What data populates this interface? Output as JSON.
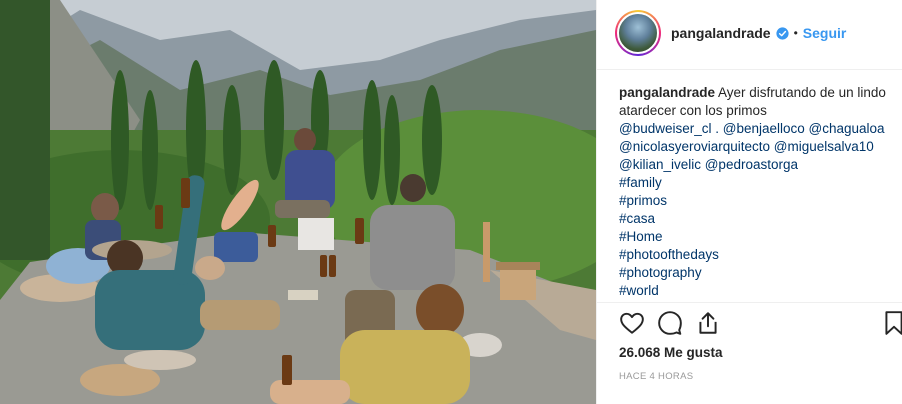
{
  "post": {
    "username": "pangalandrade",
    "follow_label": "Seguir",
    "dot": "•",
    "caption_user": "pangalandrade",
    "caption_text": " Ayer disfrutando de un lindo atardecer con los primos",
    "mentions_line1": "@budweiser_cl . @benjaelloco @chagualoa",
    "mentions_line2": "@nicolasyeroviarquitecto @miguelsalva10",
    "mentions_line3": "@kilian_ivelic @pedroastorga",
    "hashtags": [
      "#family",
      "#primos",
      "#casa",
      "#Home",
      "#photoofthedays",
      "#photography",
      "#world"
    ],
    "likes": "26.068 Me gusta",
    "time": "HACE 4 HORAS"
  },
  "colors": {
    "link": "#003569",
    "follow": "#3897f0",
    "verified": "#3897f0"
  },
  "icons": [
    "heart-icon",
    "comment-icon",
    "share-icon",
    "bookmark-icon",
    "verified-badge-icon"
  ]
}
